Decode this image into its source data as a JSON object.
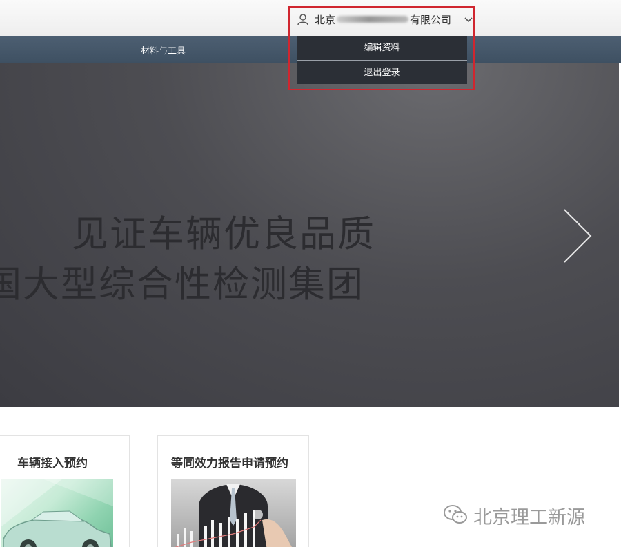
{
  "header": {
    "user_name_prefix": "北京",
    "user_name_suffix": "有限公司",
    "icons": {
      "user": "user-icon",
      "dropdown": "chevron-down-icon"
    }
  },
  "nav": {
    "items": [
      {
        "label": "材料与工具"
      }
    ]
  },
  "user_dropdown": {
    "items": [
      {
        "label": "编辑资料"
      },
      {
        "label": "退出登录"
      }
    ]
  },
  "hero": {
    "line1": "见证车辆优良品质",
    "line2": "国大型综合性检测集团",
    "next_icon": "chevron-right-icon"
  },
  "cards": [
    {
      "title": "车辆接入预约"
    },
    {
      "title": "等同效力报告申请预约"
    }
  ],
  "watermark": {
    "text": "北京理工新源",
    "icon": "wechat-icon"
  },
  "colors": {
    "nav": "#3e5062",
    "dropdown": "#2b2f36",
    "highlight": "#d0262f"
  }
}
